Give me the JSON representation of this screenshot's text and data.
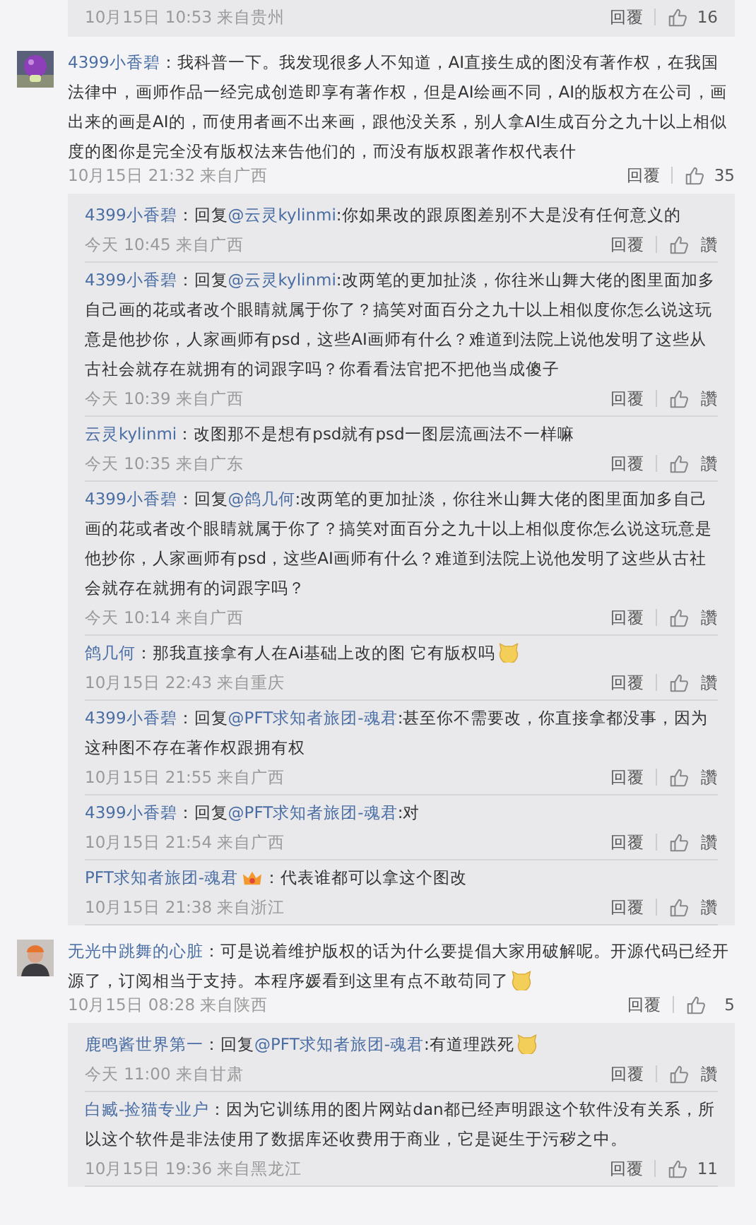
{
  "partial_reply": {
    "meta": "10月15日 10:53 来自贵州",
    "reply": "回覆",
    "likes": "16"
  },
  "comments": [
    {
      "user": "4399小香碧",
      "text": "：我科普一下。我发现很多人不知道，AI直接生成的图没有著作权，在我国法律中，画师作品一经完成创造即享有著作权，但是AI绘画不同，AI的版权方在公司，画出来的画是AI的，而使用者画不出来画，跟他没关系，别人拿AI生成百分之九十以上相似度的图你是完全没有版权法来告他们的，而没有版权跟著作权代表什",
      "meta": "10月15日 21:32 来自广西",
      "reply": "回覆",
      "likes": "35",
      "replies": [
        {
          "user": "4399小香碧",
          "pre": "：回复",
          "mention": "@云灵kylinmi",
          "text": ":你如果改的跟原图差别不大是没有任何意义的",
          "meta": "今天 10:45 来自广西",
          "reply": "回覆",
          "likes": "讚"
        },
        {
          "user": "4399小香碧",
          "pre": "：回复",
          "mention": "@云灵kylinmi",
          "text": ":改两笔的更加扯淡，你往米山舞大佬的图里面加多自己画的花或者改个眼睛就属于你了？搞笑对面百分之九十以上相似度你怎么说这玩意是他抄你，人家画师有psd，这些AI画师有什么？难道到法院上说他发明了这些从古社会就存在就拥有的词跟字吗？你看看法官把不把他当成傻子",
          "meta": "今天 10:39 来自广西",
          "reply": "回覆",
          "likes": "讚"
        },
        {
          "user": "云灵kylinmi",
          "text": "：改图那不是想有psd就有psd一图层流画法不一样嘛",
          "meta": "今天 10:35 来自广东",
          "reply": "回覆",
          "likes": "讚"
        },
        {
          "user": "4399小香碧",
          "pre": "：回复",
          "mention": "@鸽几何",
          "text": ":改两笔的更加扯淡，你往米山舞大佬的图里面加多自己画的花或者改个眼睛就属于你了？搞笑对面百分之九十以上相似度你怎么说这玩意是他抄你，人家画师有psd，这些AI画师有什么？难道到法院上说他发明了这些从古社会就存在就拥有的词跟字吗？",
          "meta": "今天 10:14 来自广西",
          "reply": "回覆",
          "likes": "讚"
        },
        {
          "user": "鸽几何",
          "text": "：那我直接拿有人在Ai基础上改的图 它有版权吗",
          "emoji": true,
          "meta": "10月15日 22:43 来自重庆",
          "reply": "回覆",
          "likes": "讚"
        },
        {
          "user": "4399小香碧",
          "pre": "：回复",
          "mention": "@PFT求知者旅团-魂君",
          "text": ":甚至你不需要改，你直接拿都没事，因为这种图不存在著作权跟拥有权",
          "meta": "10月15日 21:55 来自广西",
          "reply": "回覆",
          "likes": "讚"
        },
        {
          "user": "4399小香碧",
          "pre": "：回复",
          "mention": "@PFT求知者旅团-魂君",
          "text": ":对",
          "meta": "10月15日 21:54 来自广西",
          "reply": "回覆",
          "likes": "讚"
        },
        {
          "user": "PFT求知者旅团-魂君",
          "badge": true,
          "text": "：代表谁都可以拿这个图改",
          "meta": "10月15日 21:38 来自浙江",
          "reply": "回覆",
          "likes": "讚"
        }
      ]
    },
    {
      "user": "无光中跳舞的心脏",
      "text": "：可是说着维护版权的话为什么要提倡大家用破解呢。开源代码已经开源了，订阅相当于支持。本程序媛看到这里有点不敢苟同了",
      "emoji": true,
      "meta": "10月15日 08:28 来自陕西",
      "reply": "回覆",
      "likes": "5",
      "replies": [
        {
          "user": "鹿鸣酱世界第一",
          "pre": "：回复",
          "mention": "@PFT求知者旅团-魂君",
          "text": ":有道理跌死",
          "emoji": true,
          "meta": "今天 11:00 来自甘肃",
          "reply": "回覆",
          "likes": "讚"
        },
        {
          "user": "白臧-捡猫专业户",
          "text": "：因为它训练用的图片网站dan都已经声明跟这个软件没有关系，所以这个软件是非法使用了数据库还收费用于商业，它是诞生于污秽之中。",
          "meta": "10月15日 19:36 来自黑龙江",
          "reply": "回覆",
          "likes": "11"
        }
      ]
    }
  ]
}
